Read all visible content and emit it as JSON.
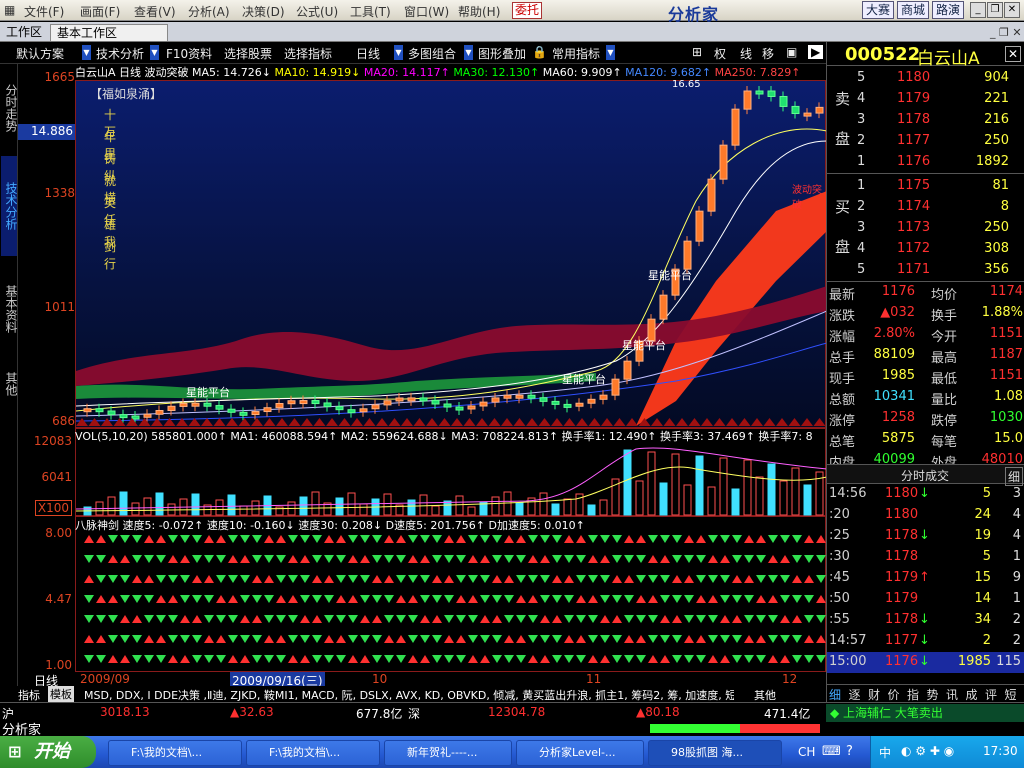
{
  "menu": {
    "items": [
      "文件(F)",
      "画面(F)",
      "查看(V)",
      "分析(A)",
      "决策(D)",
      "公式(U)",
      "工具(T)",
      "窗口(W)",
      "帮助(H)"
    ],
    "trade_btn": "委托",
    "logo": "分析家",
    "right_btns": [
      "大赛",
      "商城",
      "路演"
    ]
  },
  "tabs": {
    "left": "工作区",
    "active": "基本工作区"
  },
  "toolbar": {
    "items": [
      "默认方案",
      "技术分析",
      "F10资料",
      "选择股票",
      "选择指标",
      "日线",
      "多图组合",
      "图形叠加",
      "常用指标"
    ],
    "right_items": [
      "权",
      "线",
      "移"
    ]
  },
  "vtabs": [
    "分时走势",
    "技术分析",
    "基本资料",
    "其他"
  ],
  "main": {
    "info": {
      "stock": "白云山A 日线",
      "indicator": "波动突破",
      "ma5": "MA5: 14.726↓",
      "ma10": "MA10: 14.919↓",
      "ma20": "MA20: 14.117↑",
      "ma30": "MA30: 12.130↑",
      "ma60": "MA60: 9.909↑",
      "ma120": "MA120: 9.682↑",
      "ma250": "MA250: 7.829↑"
    },
    "price_labels": [
      "1665",
      "1338",
      "1011",
      "686"
    ],
    "cursor_price": "14.886",
    "poem_title": "【福如泉涌】",
    "poem": [
      "十 万",
      "年 里",
      "铸 纵",
      "就 横",
      "英 任",
      "雄 我",
      "剑 行"
    ],
    "annotations": [
      "星能平台",
      "星能平台",
      "星能平台",
      "星能平台",
      "16.65",
      "波动突破"
    ]
  },
  "volume": {
    "info": "VOL(5,10,20) 585801.000↑  MA1: 460088.594↑  MA2: 559624.688↓  MA3: 708224.813↑  换手率1: 12.490↑  换手率3: 37.469↑  换手率7: 8",
    "labels": [
      "12083",
      "6041",
      "X100"
    ]
  },
  "indicator": {
    "info": "八脉神剑 速度5: -0.072↑  速度10: -0.160↓  速度30: 0.208↓  D速度5: 201.756↑  D加速度5: 0.010↑",
    "labels": [
      "8.00",
      "4.47",
      "1.00"
    ]
  },
  "date_axis": {
    "period": "日线",
    "start": "2009/09",
    "cursor": "2009/09/16(三)",
    "month10": "10",
    "month11": "11",
    "month12": "12"
  },
  "indicator_bar": {
    "left": "指标",
    "tab": "模板",
    "list": "MSD, DDX, I  DDE决策 ,Ⅱ迪, ZJKD, 鞍MI1, MACD, 阮, DSLX, AVX, KD, OBVKD, 倾减, 黄买蓝出升浪, 抓主1, 筹码2, 筹, 加速度, 短, 中期见顶,",
    "right": "其他"
  },
  "quote": {
    "code": "000522",
    "name": "白云山A",
    "sell": [
      {
        "lvl": "5",
        "price": "1180",
        "vol": "904"
      },
      {
        "lvl": "4",
        "price": "1179",
        "vol": "221"
      },
      {
        "lvl": "3",
        "price": "1178",
        "vol": "216"
      },
      {
        "lvl": "2",
        "price": "1177",
        "vol": "250"
      },
      {
        "lvl": "1",
        "price": "1176",
        "vol": "1892"
      }
    ],
    "buy": [
      {
        "lvl": "1",
        "price": "1175",
        "vol": "81"
      },
      {
        "lvl": "2",
        "price": "1174",
        "vol": "8"
      },
      {
        "lvl": "3",
        "price": "1173",
        "vol": "250"
      },
      {
        "lvl": "4",
        "price": "1172",
        "vol": "308"
      },
      {
        "lvl": "5",
        "price": "1171",
        "vol": "356"
      }
    ],
    "sell_label": [
      "卖",
      "盘"
    ],
    "buy_label": [
      "买",
      "盘"
    ],
    "stats": [
      {
        "l1": "最新",
        "v1": "1176",
        "c1": "#ff3030",
        "l2": "均价",
        "v2": "1174",
        "c2": "#ff3030"
      },
      {
        "l1": "涨跌",
        "v1": "▲032",
        "c1": "#ff3030",
        "l2": "换手",
        "v2": "1.88%",
        "c2": "#ffff40"
      },
      {
        "l1": "涨幅",
        "v1": "2.80%",
        "c1": "#ff3030",
        "l2": "今开",
        "v2": "1151",
        "c2": "#ff3030"
      },
      {
        "l1": "总手",
        "v1": "88109",
        "c1": "#ffff40",
        "l2": "最高",
        "v2": "1187",
        "c2": "#ff3030"
      },
      {
        "l1": "现手",
        "v1": "1985",
        "c1": "#ffff40",
        "l2": "最低",
        "v2": "1151",
        "c2": "#ff3030"
      },
      {
        "l1": "总额",
        "v1": "10341",
        "c1": "#40e0ff",
        "l2": "量比",
        "v2": "1.08",
        "c2": "#ffff40"
      },
      {
        "l1": "涨停",
        "v1": "1258",
        "c1": "#ff3030",
        "l2": "跌停",
        "v2": "1030",
        "c2": "#30ff30"
      },
      {
        "l1": "总笔",
        "v1": "5875",
        "c1": "#ffff40",
        "l2": "每笔",
        "v2": "15.0",
        "c2": "#ffff40"
      },
      {
        "l1": "内盘",
        "v1": "40099",
        "c1": "#30ff30",
        "l2": "外盘",
        "v2": "48010",
        "c2": "#ff3030"
      }
    ],
    "trades_title": "分时成交",
    "trades_btn": "细",
    "trades": [
      {
        "t": "14:56",
        "p": "1180",
        "d": "down",
        "v": "5",
        "n": "3"
      },
      {
        "t": ":20",
        "p": "1180",
        "d": "",
        "v": "24",
        "n": "4"
      },
      {
        "t": ":25",
        "p": "1178",
        "d": "down",
        "v": "19",
        "n": "4"
      },
      {
        "t": ":30",
        "p": "1178",
        "d": "",
        "v": "5",
        "n": "1"
      },
      {
        "t": ":45",
        "p": "1179",
        "d": "up",
        "v": "15",
        "n": "9"
      },
      {
        "t": ":50",
        "p": "1179",
        "d": "",
        "v": "14",
        "n": "1"
      },
      {
        "t": ":55",
        "p": "1178",
        "d": "down",
        "v": "34",
        "n": "2"
      },
      {
        "t": "14:57",
        "p": "1177",
        "d": "down",
        "v": "2",
        "n": "2"
      },
      {
        "t": "15:00",
        "p": "1176",
        "d": "down",
        "v": "1985",
        "n": "115"
      }
    ],
    "bottom_tabs": [
      "细",
      "逐",
      "财",
      "价",
      "指",
      "势",
      "讯",
      "成",
      "评",
      "短"
    ]
  },
  "status": {
    "sh_label": "沪",
    "sh_index": "3018.13",
    "sh_change": "▲32.63",
    "sh_amount": "677.8亿",
    "sz_label": "深",
    "sz_index": "12304.78",
    "sz_change": "▲80.18",
    "sz_amount": "471.4亿",
    "ticker": "上海辅仁 大笔卖出"
  },
  "status2": {
    "left": "分析家"
  },
  "taskbar": {
    "start": "开始",
    "tasks": [
      "F:\\我的文档\\...",
      "F:\\我的文档\\...",
      "新年贺礼----...",
      "分析家Level-...",
      "98股抓图 海..."
    ],
    "ime": "CH",
    "ime2": "中",
    "time": "17:30"
  }
}
